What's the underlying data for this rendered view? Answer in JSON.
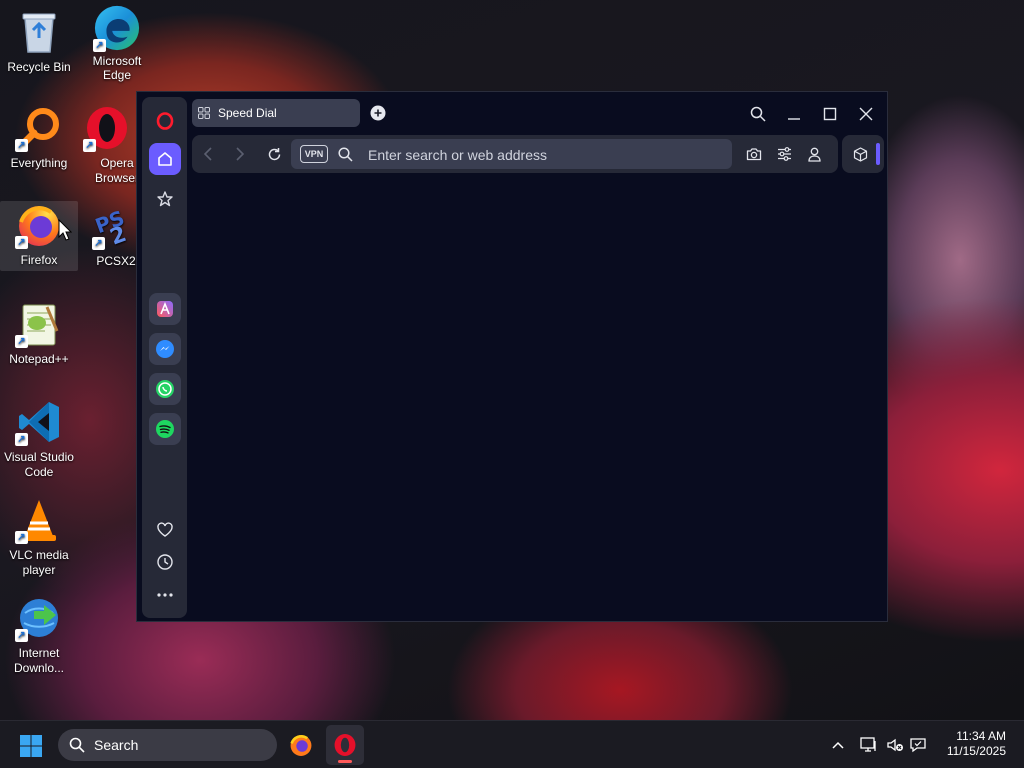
{
  "desktop": {
    "icons": [
      {
        "label": "Recycle Bin",
        "icon": "recycle-bin-icon"
      },
      {
        "label": "Microsoft Edge",
        "icon": "edge-icon"
      },
      {
        "label": "Everything",
        "icon": "everything-search-icon"
      },
      {
        "label": "Opera Browser",
        "icon": "opera-icon"
      },
      {
        "label": "Firefox",
        "icon": "firefox-icon"
      },
      {
        "label": "PCSX2",
        "icon": "pcsx2-icon"
      },
      {
        "label": "Notepad++",
        "icon": "notepadpp-icon"
      },
      {
        "label": "Visual Studio Code",
        "icon": "vscode-icon"
      },
      {
        "label": "VLC media player",
        "icon": "vlc-icon"
      },
      {
        "label": "Internet Downlo...",
        "icon": "idm-icon"
      }
    ]
  },
  "browser": {
    "tab_title": "Speed Dial",
    "vpn_label": "VPN",
    "address_placeholder": "Enter search or web address",
    "colors": {
      "accent": "#6b5cff",
      "background": "#090c1f",
      "panel": "#262937"
    }
  },
  "taskbar": {
    "search_label": "Search",
    "time": "11:34 AM",
    "date": "11/15/2025"
  }
}
